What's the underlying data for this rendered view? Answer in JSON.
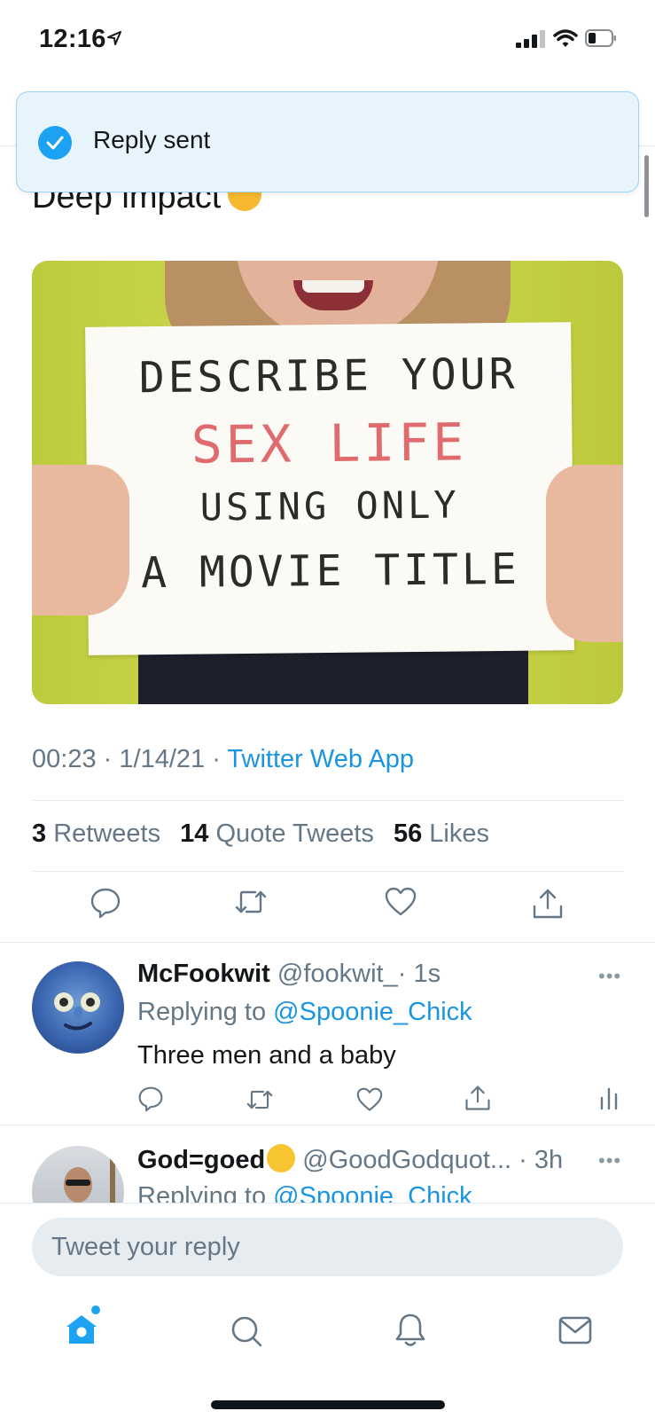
{
  "status_bar": {
    "time": "12:16",
    "icons": [
      "location-arrow-icon",
      "cellular-signal-icon",
      "wifi-icon",
      "battery-icon"
    ]
  },
  "toast": {
    "icon": "checkmark-icon",
    "label": "Reply sent"
  },
  "tweet": {
    "text": "Deep impact",
    "emoji": "thinking-face",
    "image_sign": {
      "line1": "DESCRIBE YOUR",
      "line2": "SEX LIFE",
      "line3": "USING ONLY",
      "line4": "A MOVIE TITLE"
    },
    "time": "00:23",
    "date": "1/14/21",
    "separator": "·",
    "source": "Twitter Web App",
    "stats": {
      "retweets_count": "3",
      "retweets_label": "Retweets",
      "quotes_count": "14",
      "quotes_label": "Quote Tweets",
      "likes_count": "56",
      "likes_label": "Likes"
    },
    "actions": [
      "reply-icon",
      "retweet-icon",
      "like-icon",
      "share-icon"
    ]
  },
  "replies": [
    {
      "name": "McFookwit",
      "handle": "@fookwit_",
      "time": "· 1s",
      "replying_prefix": "Replying to",
      "replying_to": "@Spoonie_Chick",
      "text": "Three men and a baby",
      "actions": [
        "reply-icon",
        "retweet-icon",
        "like-icon",
        "share-icon",
        "analytics-icon"
      ]
    },
    {
      "name": "God=goed",
      "emoji": "grinning-face",
      "handle": "@GoodGodquot...",
      "time": "· 3h",
      "replying_prefix": "Replying to",
      "replying_to": "@Spoonie_Chick"
    }
  ],
  "composer": {
    "placeholder": "Tweet your reply"
  },
  "tab_bar": {
    "items": [
      "home-icon",
      "search-icon",
      "notifications-icon",
      "messages-icon"
    ],
    "active": "home-icon"
  },
  "colors": {
    "accent": "#1da1f2",
    "link": "#1b95e0",
    "secondary_text": "#657786",
    "divider": "#e1e8ed",
    "toast_bg": "#e8f4fb"
  }
}
